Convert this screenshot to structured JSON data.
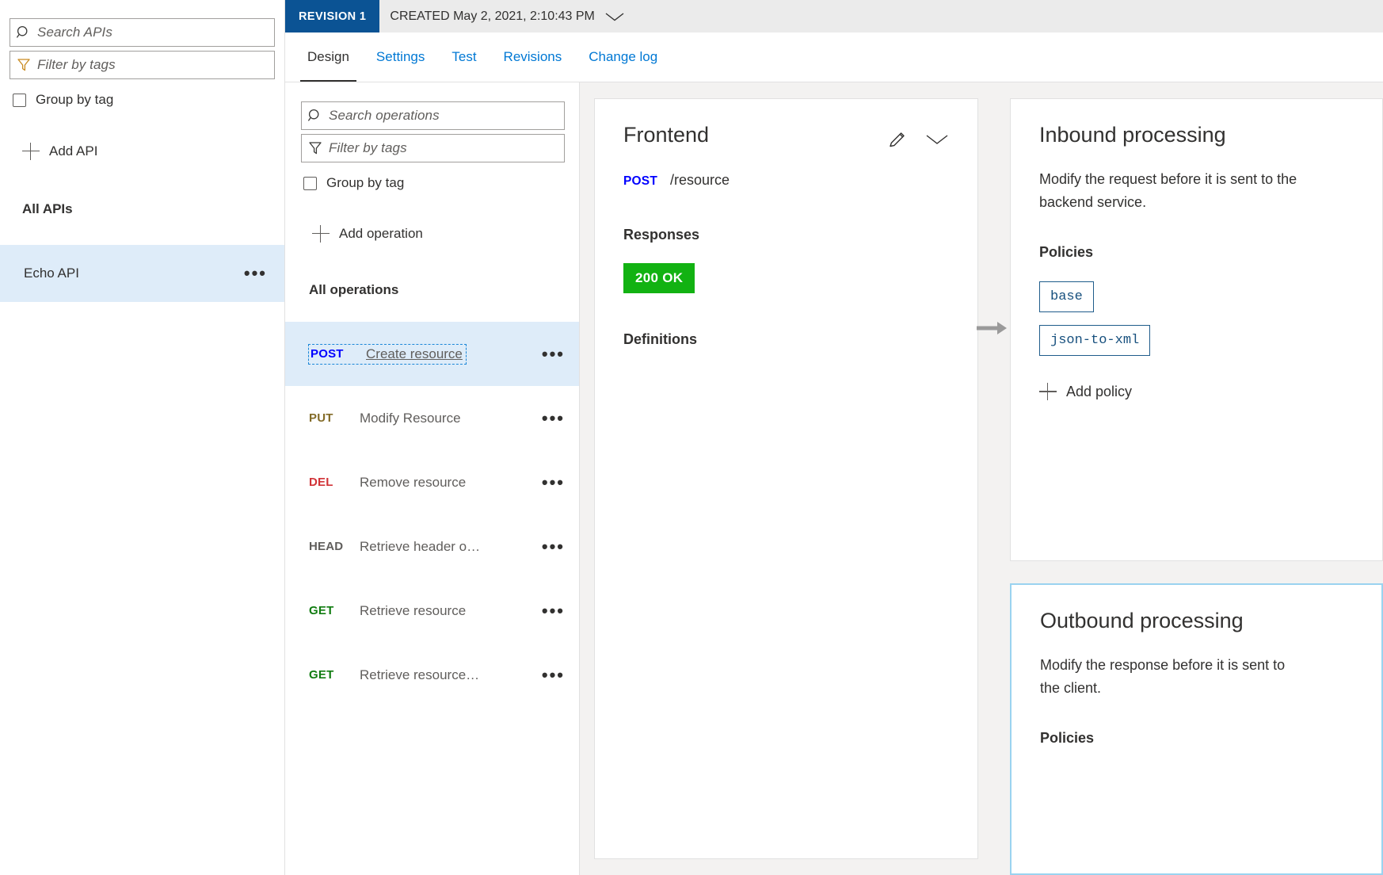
{
  "sidebar": {
    "search": {
      "placeholder": "Search APIs",
      "value": "",
      "icon": "search-icon"
    },
    "tags": {
      "placeholder": "Filter by tags",
      "value": "",
      "icon": "filter-icon"
    },
    "group_by_tag_label": "Group by tag",
    "add_api_label": "Add API",
    "all_apis_label": "All APIs",
    "apis": [
      {
        "name": "Echo API",
        "selected": true,
        "menu": "•••"
      }
    ]
  },
  "revision": {
    "badge": "REVISION 1",
    "created": "CREATED May 2, 2021, 2:10:43 PM",
    "chevron": "chevron-down-icon"
  },
  "tabs": [
    {
      "label": "Design",
      "active": true
    },
    {
      "label": "Settings",
      "active": false
    },
    {
      "label": "Test",
      "active": false
    },
    {
      "label": "Revisions",
      "active": false
    },
    {
      "label": "Change log",
      "active": false
    }
  ],
  "operations_panel": {
    "search": {
      "placeholder": "Search operations",
      "value": ""
    },
    "tags": {
      "placeholder": "Filter by tags",
      "value": ""
    },
    "group_by_tag_label": "Group by tag",
    "add_operation_label": "Add operation",
    "all_operations_label": "All operations",
    "operations": [
      {
        "verb": "POST",
        "name": "Create resource",
        "selected": true,
        "menu": "•••"
      },
      {
        "verb": "PUT",
        "name": "Modify Resource",
        "selected": false,
        "menu": "•••"
      },
      {
        "verb": "DEL",
        "name": "Remove resource",
        "selected": false,
        "menu": "•••"
      },
      {
        "verb": "HEAD",
        "name": "Retrieve header o…",
        "selected": false,
        "menu": "•••"
      },
      {
        "verb": "GET",
        "name": "Retrieve resource",
        "selected": false,
        "menu": "•••"
      },
      {
        "verb": "GET",
        "name": "Retrieve resource…",
        "selected": false,
        "menu": "•••"
      }
    ]
  },
  "frontend_card": {
    "title": "Frontend",
    "method": "POST",
    "path": "/resource",
    "responses_label": "Responses",
    "response_badge": "200 OK",
    "definitions_label": "Definitions",
    "edit_icon": "pencil-icon",
    "expand_icon": "chevron-down-icon"
  },
  "inbound_card": {
    "title": "Inbound processing",
    "description": "Modify the request before it is sent to the backend service.",
    "policies_label": "Policies",
    "policies": [
      "base",
      "json-to-xml"
    ],
    "add_policy_label": "Add policy"
  },
  "outbound_card": {
    "title": "Outbound processing",
    "description": "Modify the response before it is sent to the client.",
    "policies_label": "Policies"
  },
  "colors": {
    "revision_badge_bg": "#0b5394",
    "tab_link": "#0078d4",
    "selection_bg": "#deecf9",
    "badge_ok_bg": "#12b212",
    "verb_post": "#0000ff",
    "verb_put": "#836b28",
    "verb_del": "#d13438",
    "verb_head": "#605e5c",
    "verb_get": "#107c10",
    "chip_border": "#1f5c8b",
    "canvas_bg": "#f3f2f1",
    "outbound_border": "#9ad3f0"
  }
}
